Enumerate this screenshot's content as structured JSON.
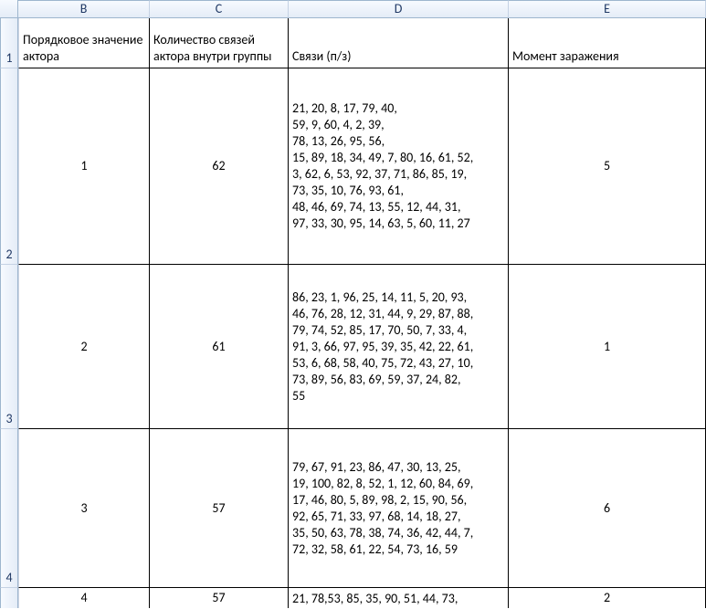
{
  "columns": {
    "B": "B",
    "C": "C",
    "D": "D",
    "E": "E"
  },
  "rowlabels": {
    "r1": "1",
    "r2": "2",
    "r3": "3",
    "r4": "4"
  },
  "headers": {
    "B": "Порядковое значение актора",
    "C": "Количество связей актора внутри группы",
    "D": "Связи (п/з)",
    "E": "Момент заражения"
  },
  "rows": [
    {
      "B": "1",
      "C": "62",
      "D": "21, 20, 8, 17, 79, 40,\n59, 9, 60, 4, 2, 39,\n78, 13, 26, 95, 56,\n15, 89, 18, 34, 49, 7, 80, 16, 61, 52,\n3, 62, 6, 53, 92, 37, 71, 86, 85, 19,\n73, 35, 10, 76, 93, 61,\n48, 46, 69, 74, 13, 55, 12, 44, 31,\n97, 33, 30, 95, 14, 63, 5, 60, 11, 27",
      "E": "5"
    },
    {
      "B": "2",
      "C": "61",
      "D": "86, 23, 1, 96, 25, 14, 11, 5, 20, 93,\n46, 76, 28, 12, 31, 44, 9, 29, 87, 88,\n79, 74, 52, 85, 17, 70, 50, 7, 33, 4,\n91, 3, 66, 97, 95, 39, 35, 42, 22, 61,\n53, 6, 68, 58, 40, 75, 72, 43, 27, 10,\n73, 89, 56, 83, 69, 59, 37, 24, 82,\n55",
      "E": "1"
    },
    {
      "B": "3",
      "C": "57",
      "D": "79, 67, 91, 23, 86, 47, 30, 13, 25,\n19, 100, 82, 8, 52, 1, 12, 60, 84, 69,\n17, 46, 80, 5, 89, 98, 2, 15, 90, 56,\n92, 65, 71, 33, 97, 68, 14, 18, 27,\n35, 50, 63, 78, 38, 74, 36, 42, 44, 7,\n72, 32, 58, 61, 22, 54, 73, 16, 59",
      "E": "6"
    },
    {
      "B": "4",
      "C": "57",
      "D": "21, 78,53, 85, 35, 90, 51, 44, 73,",
      "E": "2"
    }
  ]
}
